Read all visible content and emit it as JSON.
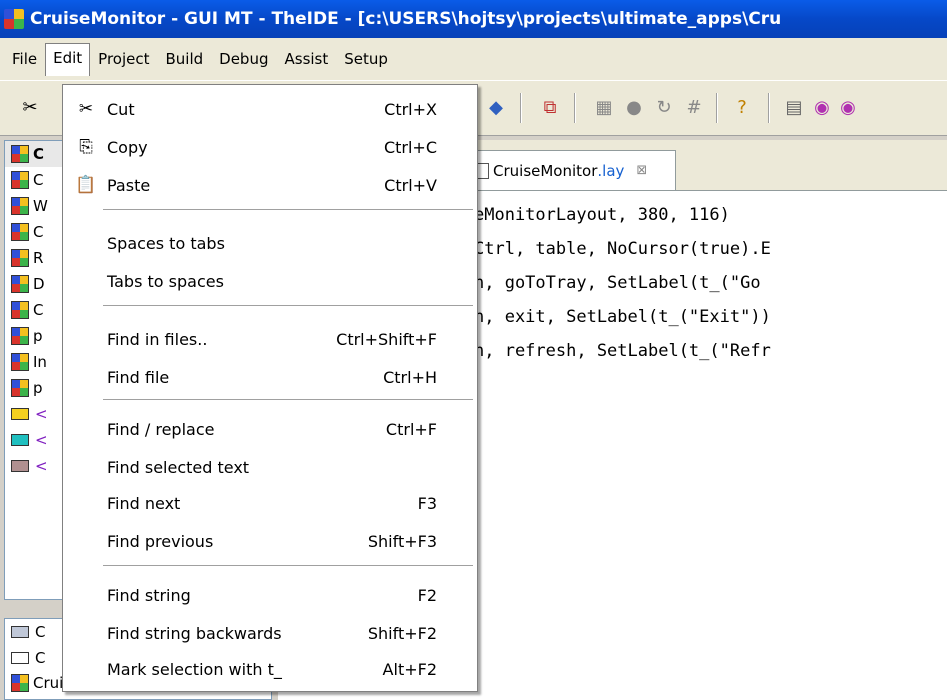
{
  "window": {
    "title": "CruiseMonitor - GUI MT - TheIDE - [c:\\USERS\\hojtsy\\projects\\ultimate_apps\\Cru"
  },
  "menubar": {
    "items": [
      "File",
      "Edit",
      "Project",
      "Build",
      "Debug",
      "Assist",
      "Setup"
    ]
  },
  "dropdown": {
    "items": [
      {
        "icon": "scissors-icon",
        "glyph": "✂",
        "label": "Cut",
        "shortcut": "Ctrl+X"
      },
      {
        "icon": "copy-icon",
        "glyph": "⎘",
        "label": "Copy",
        "shortcut": "Ctrl+C"
      },
      {
        "icon": "paste-icon",
        "glyph": "📋",
        "label": "Paste",
        "shortcut": "Ctrl+V"
      },
      {
        "label": "Spaces to tabs",
        "shortcut": ""
      },
      {
        "label": "Tabs to spaces",
        "shortcut": ""
      },
      {
        "label": "Find in files..",
        "shortcut": "Ctrl+Shift+F"
      },
      {
        "label": "Find file",
        "shortcut": "Ctrl+H"
      },
      {
        "label": "Find / replace",
        "shortcut": "Ctrl+F"
      },
      {
        "label": "Find selected text",
        "shortcut": ""
      },
      {
        "label": "Find next",
        "shortcut": "F3"
      },
      {
        "label": "Find previous",
        "shortcut": "Shift+F3"
      },
      {
        "label": "Find string",
        "shortcut": "F2"
      },
      {
        "label": "Find string backwards",
        "shortcut": "Shift+F2"
      },
      {
        "label": "Mark selection with t_",
        "shortcut": "Alt+F2"
      }
    ]
  },
  "editor": {
    "tab": {
      "name": "CruiseMonitor",
      "ext": ".lay",
      "close": "⊠"
    },
    "lines": [
      "eMonitorLayout, 380, 116)",
      "Ctrl, table, NoCursor(true).E",
      "n, goToTray, SetLabel(t_(\"Go",
      "n, exit, SetLabel(t_(\"Exit\"))",
      "n, refresh, SetLabel(t_(\"Refr"
    ]
  },
  "leftpanel": {
    "rows": [
      "C",
      "C",
      "W",
      "C",
      "R",
      "D",
      "C",
      "p",
      "In",
      "p",
      "<",
      "<",
      "<"
    ]
  },
  "leftpanel2": {
    "rows": [
      "C",
      "C",
      "CruiseMonitor.iml"
    ]
  },
  "colors": {
    "titlebar": "#0648c8",
    "menu_bg": "#ece9d8",
    "highlight_tab": "#1560d0"
  }
}
